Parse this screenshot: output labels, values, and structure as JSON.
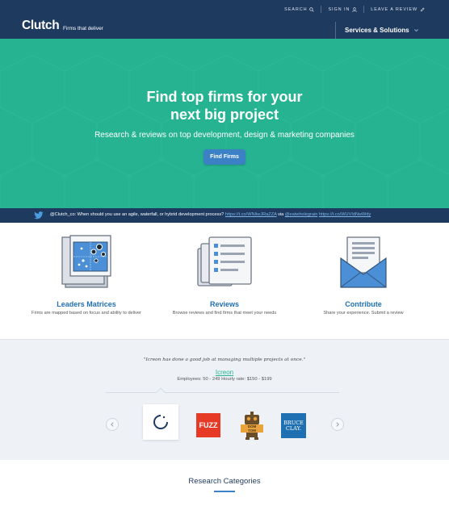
{
  "header": {
    "logo": "Clutch",
    "tagline": "Firms that deliver",
    "nav": [
      {
        "label": "SEARCH",
        "icon": "search-icon"
      },
      {
        "label": "SIGN IN",
        "icon": "user-icon"
      },
      {
        "label": "LEAVE A REVIEW",
        "icon": "pencil-icon"
      }
    ],
    "services_label": "Services & Solutions"
  },
  "hero": {
    "title_line1": "Find top firms for your",
    "title_line2": "next big project",
    "subtitle": "Research & reviews on top development, design & marketing companies",
    "button_label": "Find Firms"
  },
  "tweet": {
    "text": "@Clutch_co: When should you use an agile, waterfall, or hybrid development process?",
    "link1": "https://t.co/WNIiwJRaZZA",
    "via": "via",
    "handle": "@eatwholegrain",
    "link2": "https://t.co/WUVIdNwWdy"
  },
  "features": [
    {
      "title": "Leaders Matrices",
      "desc": "Firms are mapped based on focus and ability to deliver",
      "icon": "matrix-icon"
    },
    {
      "title": "Reviews",
      "desc": "Browse reviews and find firms that meet your needs",
      "icon": "reviews-documents-icon"
    },
    {
      "title": "Contribute",
      "desc": "Share your experience. Submit a review",
      "icon": "envelope-icon"
    }
  ],
  "testimonial": {
    "quote": "\"Icreon has done a good job at managing multiple projects at once.\"",
    "company": "Icreon",
    "meta": "Employees: 50 - 249   Hourly rate: $150 - $199",
    "logos": [
      {
        "name": "Icreon",
        "icon": "icreon-logo"
      },
      {
        "name": "FUZZ"
      },
      {
        "name": "DOM & TOM",
        "line1": "DOM",
        "line2": "TOM"
      },
      {
        "name": "Bruce Clay",
        "line1": "BRUCE",
        "line2": "CLAY."
      }
    ]
  },
  "research": {
    "title": "Research Categories"
  },
  "colors": {
    "navy": "#1f3a5f",
    "teal": "#25b391",
    "blue": "#1f6fb3",
    "button": "#3c81c6"
  }
}
